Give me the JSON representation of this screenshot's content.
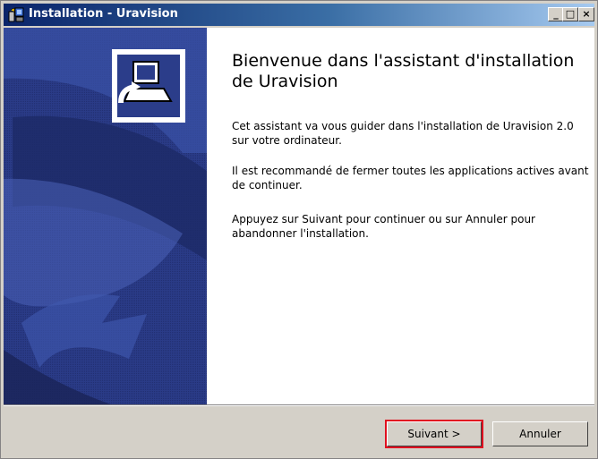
{
  "window": {
    "title": "Installation - Uravision",
    "controls": {
      "minimize": "_",
      "maximize": "□",
      "close": "×"
    }
  },
  "main": {
    "heading": "Bienvenue dans l'assistant d'installation de Uravision",
    "paragraphs": [
      "Cet assistant va vous guider dans l'installation de Uravision 2.0 sur votre ordinateur.",
      "Il est recommandé de fermer toutes les applications actives avant de continuer.",
      "Appuyez sur Suivant pour continuer ou sur Annuler pour abandonner l'installation."
    ]
  },
  "buttons": {
    "next": "Suivant >",
    "cancel": "Annuler"
  },
  "colors": {
    "titlebar_start": "#0a246a",
    "titlebar_end": "#a6caf0",
    "sidebar_blue": "#25357a",
    "default_button_highlight": "#e01020"
  },
  "icons": [
    "installer-icon",
    "setup-computer-icon"
  ]
}
